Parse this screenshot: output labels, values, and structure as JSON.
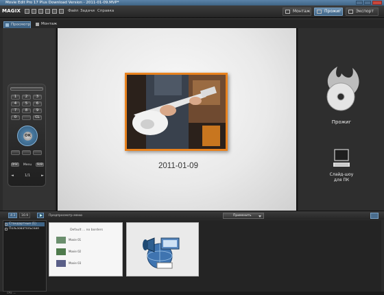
{
  "window": {
    "title": "Movie Edit Pro 17 Plus Download Version - 2011-01-09.MVP*"
  },
  "menubar": {
    "logo": "MAGIX",
    "menus": [
      "Файл",
      "Задачи",
      "Справка"
    ],
    "modes": {
      "edit": "Монтаж",
      "burn": "Прожиг",
      "export": "Экспорт"
    }
  },
  "tabs": {
    "preview": "Просмотр",
    "edit": "Монтаж"
  },
  "remote": {
    "keys": [
      "1",
      "2",
      "3",
      "4",
      "5",
      "6",
      "7",
      "8",
      "9",
      "0",
      "",
      "CL"
    ],
    "ok": "OK",
    "disc": "DISC",
    "menu": "Menu",
    "sub": "SUB",
    "page": "1/1"
  },
  "preview": {
    "title": "2011-01-09"
  },
  "right": {
    "burn_label": "Прожиг",
    "slideshow_label_1": "Слайд-шоу",
    "slideshow_label_2": "для ПК"
  },
  "bottom": {
    "aspect_43": "4:3",
    "aspect_169": "16:9",
    "preview_menu": "Предпросмотр меню",
    "apply": "Применить"
  },
  "tree": {
    "items": [
      "Стандартные (1)",
      "Пользовательские"
    ]
  },
  "template": {
    "title": "Default ... no borders",
    "movies": [
      "Movie 01",
      "Movie 02",
      "Movie 03"
    ],
    "swatches": [
      "#6b8f6e",
      "#4e7a4c",
      "#5a5f88"
    ]
  },
  "status": {
    "cpu": "CPU: —"
  }
}
